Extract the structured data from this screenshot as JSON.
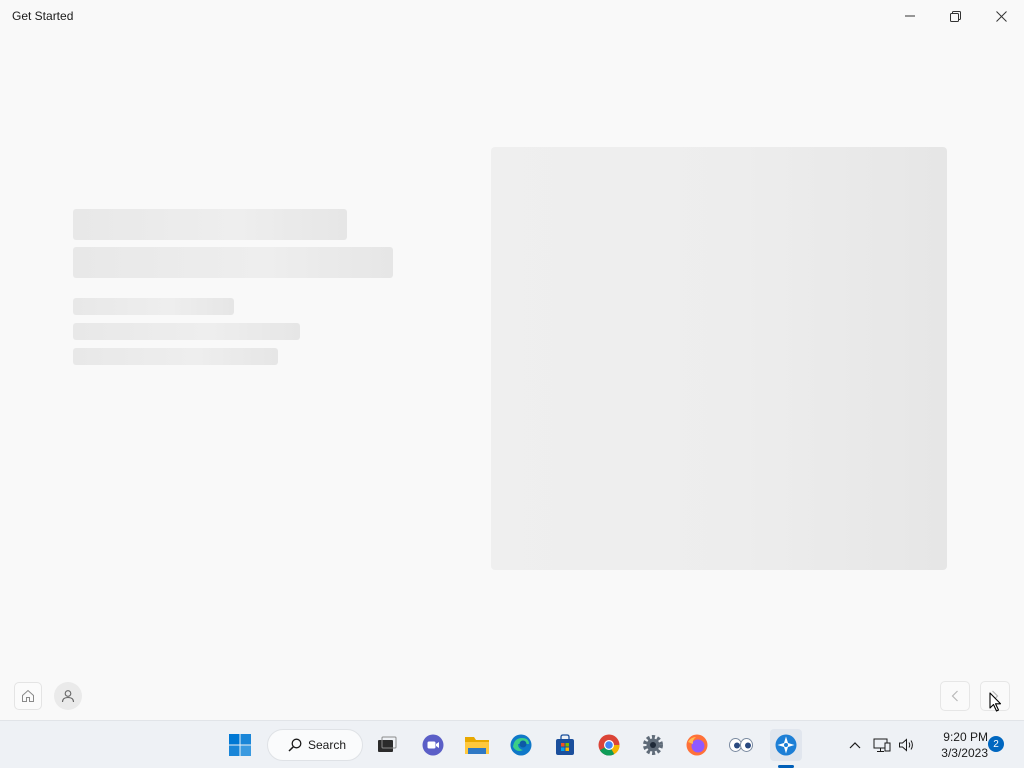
{
  "window": {
    "title": "Get Started"
  },
  "taskbar": {
    "search_label": "Search",
    "time": "9:20 PM",
    "date": "3/3/2023",
    "notification_count": "2",
    "accent": "#005fb8"
  }
}
